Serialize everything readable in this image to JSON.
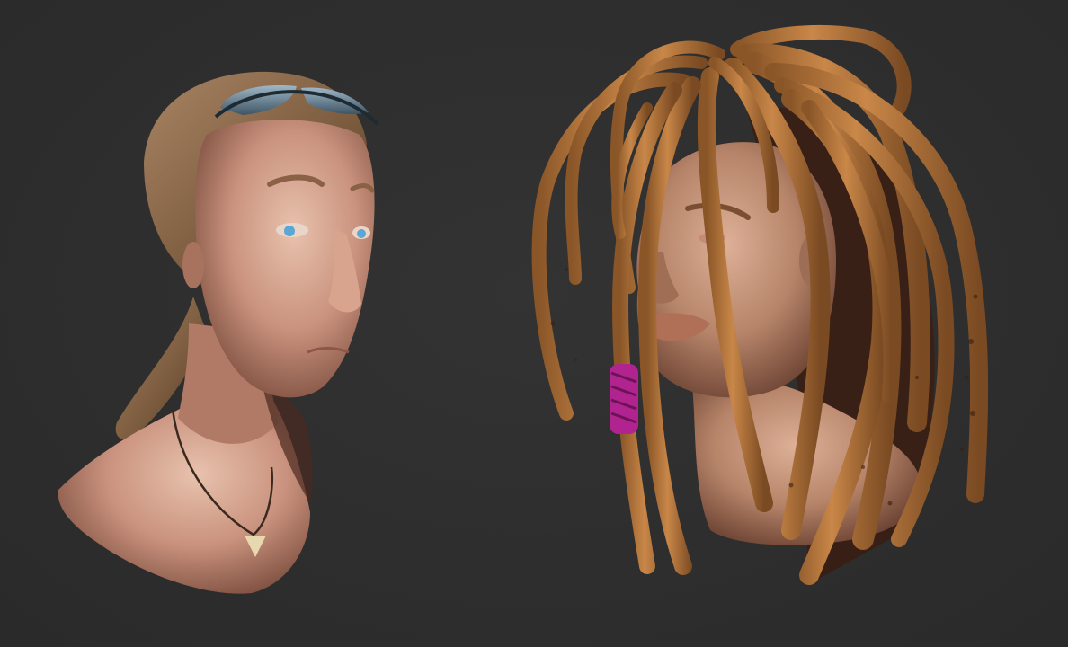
{
  "scene": {
    "background_color": "#2d2d2d",
    "subjects": [
      {
        "id": "left-bust",
        "skin_color": "#c9927e",
        "hair_color": "#8a6748",
        "eye_color": "#5aa6d6",
        "accessories": [
          "sunglasses-on-head",
          "necklace-pendant"
        ]
      },
      {
        "id": "right-bust",
        "skin_color": "#b68469",
        "hair_color": "#b8783f",
        "accent_color": "#b1248f",
        "accessories": [
          "dreadlocks",
          "hair-wrap"
        ]
      }
    ]
  }
}
